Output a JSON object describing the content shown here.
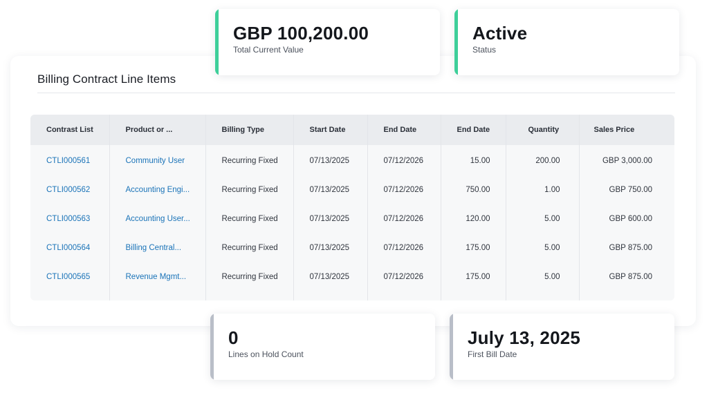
{
  "cards": [
    {
      "value": "GBP 100,200.00",
      "label": "Total Current Value",
      "accent": "#3ecf9a"
    },
    {
      "value": "Active",
      "label": "Status",
      "accent": "#3ecf9a"
    },
    {
      "value": "0",
      "label": "Lines on Hold Count",
      "accent": "#b9bec8"
    },
    {
      "value": "July 13, 2025",
      "label": "First Bill Date",
      "accent": "#b9bec8"
    }
  ],
  "panel": {
    "title": "Billing Contract Line Items",
    "columns": [
      "Contrast List",
      "Product or ...",
      "Billing Type",
      "Start Date",
      "End Date",
      "End Date",
      "Quantity",
      "Sales Price"
    ],
    "rows": [
      {
        "id": "CTLI000561",
        "product": "Community User",
        "billing_type": "Recurring Fixed",
        "start": "07/13/2025",
        "end": "07/12/2026",
        "end2": "15.00",
        "quantity": "200.00",
        "price": "GBP 3,000.00"
      },
      {
        "id": "CTLI000562",
        "product": "Accounting Engi...",
        "billing_type": "Recurring Fixed",
        "start": "07/13/2025",
        "end": "07/12/2026",
        "end2": "750.00",
        "quantity": "1.00",
        "price": "GBP 750.00"
      },
      {
        "id": "CTLI000563",
        "product": "Accounting User...",
        "billing_type": "Recurring Fixed",
        "start": "07/13/2025",
        "end": "07/12/2026",
        "end2": "120.00",
        "quantity": "5.00",
        "price": "GBP 600.00"
      },
      {
        "id": "CTLI000564",
        "product": "Billing Central...",
        "billing_type": "Recurring Fixed",
        "start": "07/13/2025",
        "end": "07/12/2026",
        "end2": "175.00",
        "quantity": "5.00",
        "price": "GBP 875.00"
      },
      {
        "id": "CTLI000565",
        "product": "Revenue Mgmt...",
        "billing_type": "Recurring Fixed",
        "start": "07/13/2025",
        "end": "07/12/2026",
        "end2": "175.00",
        "quantity": "5.00",
        "price": "GBP 875.00"
      }
    ]
  }
}
